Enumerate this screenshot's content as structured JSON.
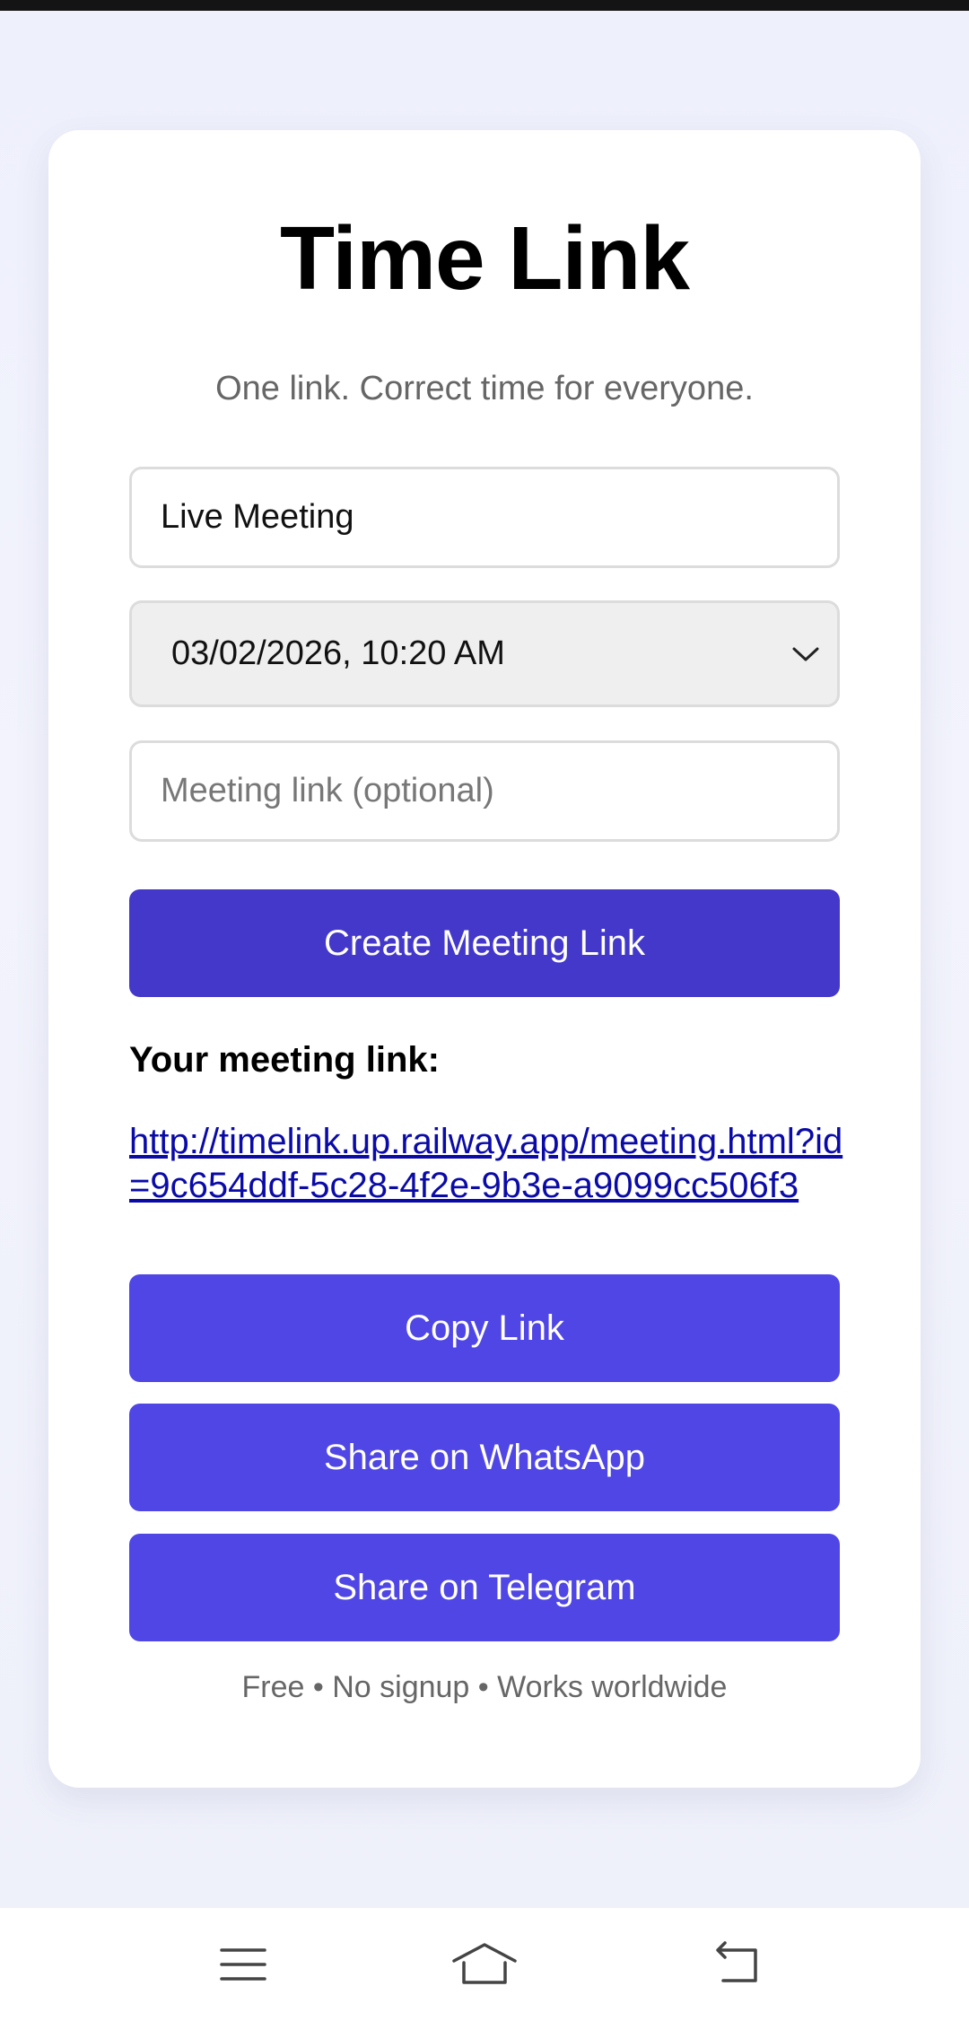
{
  "app": {
    "title": "Time Link",
    "subtitle": "One link. Correct time for everyone."
  },
  "form": {
    "title_value": "Live Meeting",
    "datetime_value": "03/02/2026, 10:20 AM",
    "link_placeholder": "Meeting link (optional)",
    "link_value": "",
    "create_label": "Create Meeting Link"
  },
  "result": {
    "label": "Your meeting link:",
    "url": "http://timelink.up.railway.app/meeting.html?id=9c654ddf-5c28-4f2e-9b3e-a9099cc506f3",
    "copy_label": "Copy Link",
    "whatsapp_label": "Share on WhatsApp",
    "telegram_label": "Share on Telegram"
  },
  "footer": {
    "note": "Free • No signup • Works worldwide"
  },
  "system_nav": {
    "icons": [
      "menu-icon",
      "home-icon",
      "back-icon"
    ]
  },
  "colors": {
    "primary_button": "#4338ca",
    "secondary_button": "#4f46e5",
    "link": "#0a0aa8",
    "background": "#eef0fc"
  }
}
